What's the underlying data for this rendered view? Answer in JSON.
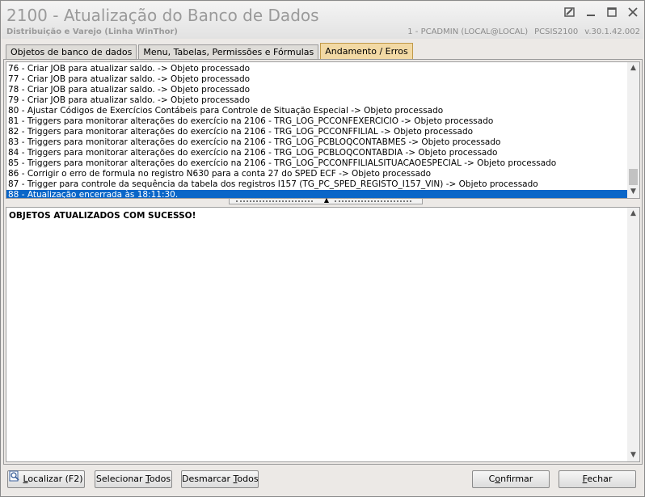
{
  "window": {
    "title": "2100 - Atualização do Banco de Dados",
    "subtitle": "Distribuição e Varejo (Linha WinThor)",
    "session": "1 - PCADMIN (LOCAL@LOCAL)",
    "program": "PCSIS2100",
    "version": "v.30.1.42.002"
  },
  "tabs": [
    {
      "label": "Objetos de banco de dados"
    },
    {
      "label": "Menu, Tabelas, Permissões e Fórmulas"
    },
    {
      "label": "Andamento / Erros"
    }
  ],
  "log_lines": [
    "76 - Criar JOB para atualizar saldo.  -> Objeto processado",
    "77 - Criar JOB para atualizar saldo.  -> Objeto processado",
    "78 - Criar JOB para atualizar saldo.  -> Objeto processado",
    "79 - Criar JOB para atualizar saldo.  -> Objeto processado",
    "80 - Ajustar Códigos de Exercícios Contábeis para Controle de Situação Especial  -> Objeto processado",
    "81 - Triggers para monitorar alterações do exercício na 2106 - TRG_LOG_PCCONFEXERCICIO  -> Objeto processado",
    "82 - Triggers para monitorar alterações do exercício na 2106 - TRG_LOG_PCCONFFILIAL  -> Objeto processado",
    "83 - Triggers para monitorar alterações do exercício na 2106 - TRG_LOG_PCBLOQCONTABMES  -> Objeto processado",
    "84 - Triggers para monitorar alterações do exercício na 2106 - TRG_LOG_PCBLOQCONTABDIA  -> Objeto processado",
    "85 - Triggers para monitorar alterações do exercício na 2106 - TRG_LOG_PCCONFFILIALSITUACAOESPECIAL  -> Objeto processado",
    "86 - Corrigir o erro de formula no registro N630 para a conta 27 do SPED ECF  -> Objeto processado",
    "87 - Trigger para controle da sequência da  tabela dos registros I157 (TG_PC_SPED_REGISTO_I157_VIN)  -> Objeto processado",
    "88 - Atualização encerrada às 18:11:30."
  ],
  "result_message": "OBJETOS ATUALIZADOS COM SUCESSO!",
  "buttons": {
    "localizar": {
      "pre": "",
      "u": "L",
      "post": "ocalizar (F2)"
    },
    "selecionar": {
      "pre": "Selecionar ",
      "u": "T",
      "post": "odos"
    },
    "desmarcar": {
      "pre": "Desmarcar ",
      "u": "T",
      "post": "odos"
    },
    "confirmar": {
      "pre": "C",
      "u": "o",
      "post": "nfirmar"
    },
    "fechar": {
      "pre": "",
      "u": "F",
      "post": "echar"
    }
  },
  "colors": {
    "selection": "#0a66c8",
    "active_tab": "#f2d9a4"
  }
}
